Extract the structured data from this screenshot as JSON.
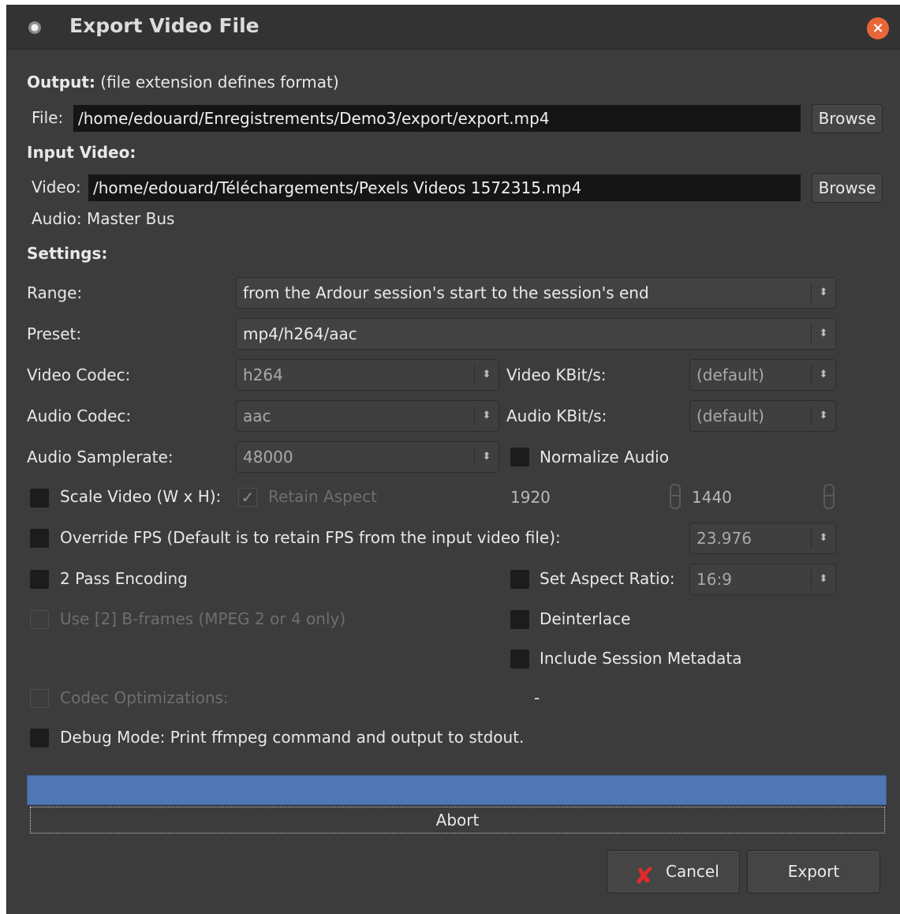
{
  "window": {
    "title": "Export Video File",
    "close_icon": "×"
  },
  "output": {
    "heading": "Output:",
    "heading_note": "(file extension defines format)",
    "file_label": "File:",
    "file_value": "/home/edouard/Enregistrements/Demo3/export/export.mp4",
    "browse_label": "Browse"
  },
  "input": {
    "heading": "Input Video:",
    "video_label": "Video:",
    "video_value": "/home/edouard/Téléchargements/Pexels Videos 1572315.mp4",
    "browse_label": "Browse",
    "audio_label": "Audio:",
    "audio_value": "Master Bus"
  },
  "settings": {
    "heading": "Settings:",
    "range_label": "Range:",
    "range_value": "from the Ardour session's start to the session's end",
    "preset_label": "Preset:",
    "preset_value": "mp4/h264/aac",
    "video_codec_label": "Video Codec:",
    "video_codec_value": "h264",
    "video_kbit_label": "Video KBit/s:",
    "video_kbit_value": "(default)",
    "audio_codec_label": "Audio Codec:",
    "audio_codec_value": "aac",
    "audio_kbit_label": "Audio KBit/s:",
    "audio_kbit_value": "(default)",
    "samplerate_label": "Audio Samplerate:",
    "samplerate_value": "48000",
    "normalize_label": "Normalize Audio",
    "scale_label": "Scale Video (W x H):",
    "retain_aspect_label": "Retain Aspect",
    "scale_width": "1920",
    "scale_height": "1440",
    "override_fps_label": "Override FPS (Default is to retain FPS from the input video file):",
    "fps_value": "23.976",
    "two_pass_label": "2 Pass Encoding",
    "aspect_ratio_label": "Set Aspect Ratio:",
    "aspect_ratio_value": "16:9",
    "bframes_label": "Use [2] B-frames (MPEG 2 or 4 only)",
    "deinterlace_label": "Deinterlace",
    "metadata_label": "Include Session Metadata",
    "codec_opt_label": "Codec Optimizations:",
    "codec_opt_value": "-",
    "debug_label": "Debug Mode: Print ffmpeg command and output to stdout."
  },
  "progress": {
    "fraction": 1.0,
    "abort_label": "Abort"
  },
  "buttons": {
    "cancel_label": "Cancel",
    "export_label": "Export"
  },
  "colors": {
    "progress": "#5077b4",
    "close": "#e9663a",
    "cancel_icon": "#e02b2b"
  }
}
